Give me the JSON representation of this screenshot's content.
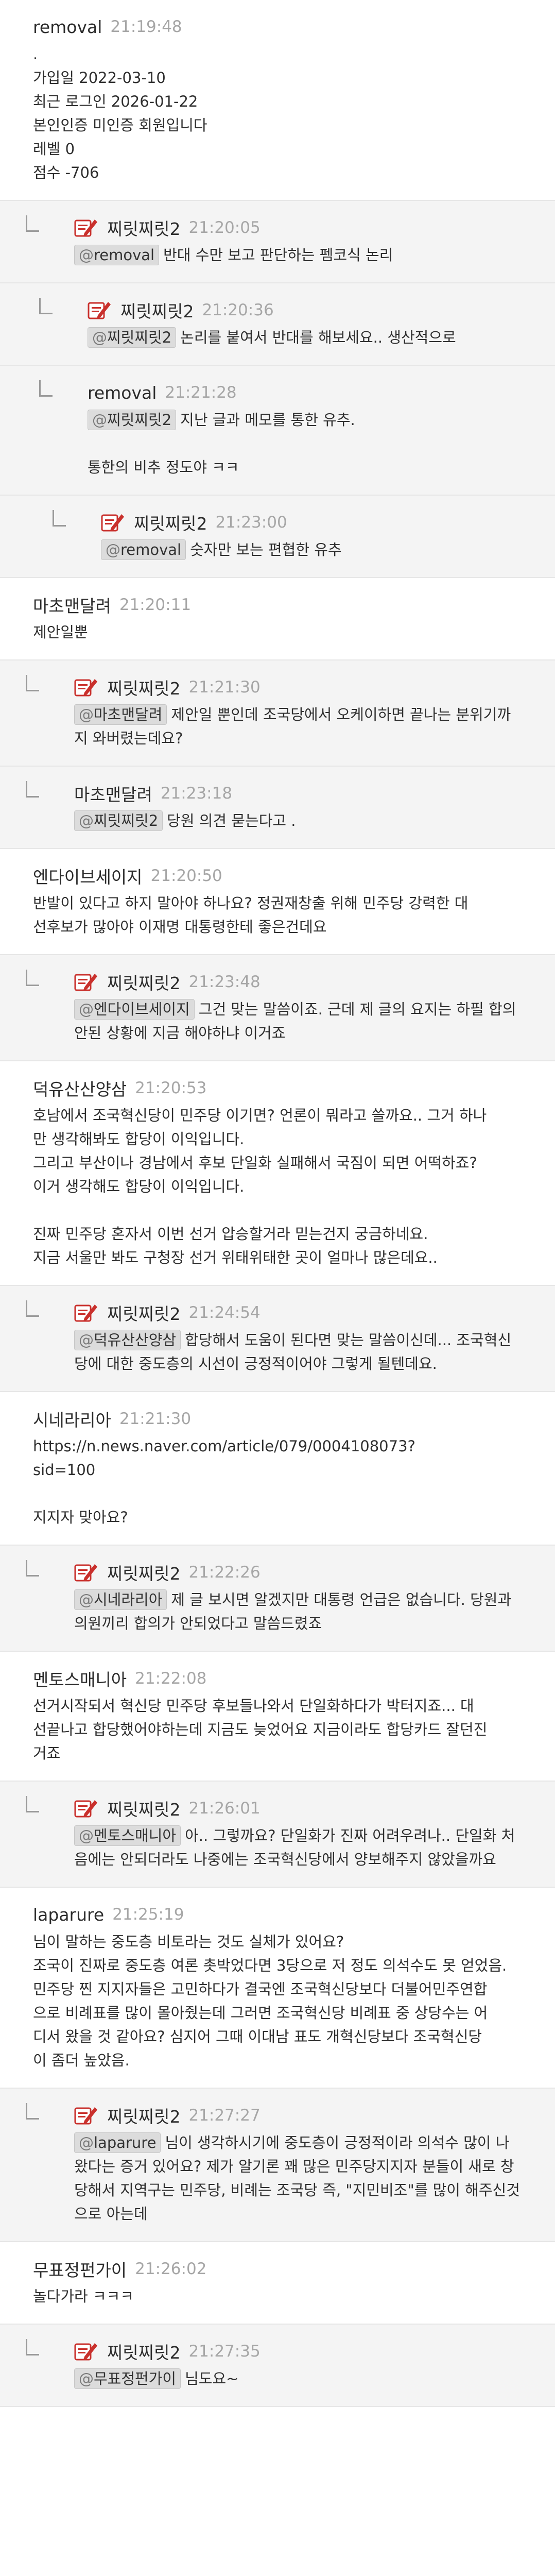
{
  "comments": [
    {
      "level": 0,
      "nick": "removal",
      "time": "21:19:48",
      "badge": false,
      "mention": "",
      "lines": [
        ".",
        "가입일 2022-03-10",
        "최근 로그인 2026-01-22",
        "본인인증 미인증 회원입니다",
        "레벨 0",
        "점수 -706"
      ]
    },
    {
      "level": 1,
      "nick": "찌릿찌릿2",
      "time": "21:20:05",
      "badge": true,
      "mention": "removal",
      "lines": [
        "반대 수만 보고 판단하는 펨코식 논리"
      ]
    },
    {
      "level": 2,
      "nick": "찌릿찌릿2",
      "time": "21:20:36",
      "badge": true,
      "mention": "찌릿찌릿2",
      "lines": [
        "논리를 붙여서 반대를 해보세요.. 생산적으로"
      ]
    },
    {
      "level": 2,
      "nick": "removal",
      "time": "21:21:28",
      "badge": false,
      "mention": "찌릿찌릿2",
      "lines": [
        "지난 글과 메모를 통한 유추.",
        "",
        "통한의 비추 정도야 ㅋㅋ"
      ]
    },
    {
      "level": 3,
      "nick": "찌릿찌릿2",
      "time": "21:23:00",
      "badge": true,
      "mention": "removal",
      "lines": [
        "숫자만 보는 편협한 유추"
      ]
    },
    {
      "level": 0,
      "nick": "마초맨달려",
      "time": "21:20:11",
      "badge": false,
      "mention": "",
      "lines": [
        "제안일뿐"
      ]
    },
    {
      "level": 1,
      "nick": "찌릿찌릿2",
      "time": "21:21:30",
      "badge": true,
      "mention": "마초맨달려",
      "lines": [
        "제안일 뿐인데 조국당에서 오케이하면 끝나는 분위기까",
        "지 와버렸는데요?"
      ]
    },
    {
      "level": 1,
      "nick": "마초맨달려",
      "time": "21:23:18",
      "badge": false,
      "mention": "찌릿찌릿2",
      "lines": [
        "당원 의견 묻는다고 ."
      ]
    },
    {
      "level": 0,
      "nick": "엔다이브세이지",
      "time": "21:20:50",
      "badge": false,
      "mention": "",
      "lines": [
        "반발이 있다고 하지 말아야 하나요? 정권재창출 위해 민주당 강력한 대",
        "선후보가 많아야 이재명 대통령한테 좋은건데요"
      ]
    },
    {
      "level": 1,
      "nick": "찌릿찌릿2",
      "time": "21:23:48",
      "badge": true,
      "mention": "엔다이브세이지",
      "lines": [
        "그건 맞는 말씀이죠. 근데 제 글의 요지는 하필 합의",
        "안된 상황에 지금 해야하냐 이거죠"
      ]
    },
    {
      "level": 0,
      "nick": "덕유산산양삼",
      "time": "21:20:53",
      "badge": false,
      "mention": "",
      "lines": [
        "호남에서 조국혁신당이 민주당 이기면? 언론이 뭐라고 쓸까요.. 그거 하나",
        "만 생각해봐도 합당이 이익입니다.",
        "그리고 부산이나 경남에서 후보 단일화 실패해서 국짐이 되면 어떡하죠?",
        "이거 생각해도 합당이 이익입니다.",
        "",
        "진짜 민주당 혼자서 이번 선거 압승할거라 믿는건지 궁금하네요.",
        "지금 서울만 봐도 구청장 선거 위태위태한 곳이 얼마나 많은데요.."
      ]
    },
    {
      "level": 1,
      "nick": "찌릿찌릿2",
      "time": "21:24:54",
      "badge": true,
      "mention": "덕유산산양삼",
      "lines": [
        "합당해서 도움이 된다면 맞는 말씀이신데... 조국혁신",
        "당에 대한 중도층의 시선이 긍정적이어야 그렇게 될텐데요."
      ]
    },
    {
      "level": 0,
      "nick": "시네라리아",
      "time": "21:21:30",
      "badge": false,
      "mention": "",
      "lines": [
        "https://n.news.naver.com/article/079/0004108073?",
        "sid=100",
        "",
        "지지자 맞아요?"
      ]
    },
    {
      "level": 1,
      "nick": "찌릿찌릿2",
      "time": "21:22:26",
      "badge": true,
      "mention": "시네라리아",
      "lines": [
        "제 글 보시면 알겠지만 대통령 언급은 없습니다. 당원과",
        "의원끼리 합의가 안되었다고 말씀드렸죠"
      ]
    },
    {
      "level": 0,
      "nick": "멘토스매니아",
      "time": "21:22:08",
      "badge": false,
      "mention": "",
      "lines": [
        "선거시작되서 혁신당 민주당 후보들나와서 단일화하다가 박터지죠... 대",
        "선끝나고 합당했어야하는데 지금도 늦었어요 지금이라도 합당카드 잘던진",
        "거죠"
      ]
    },
    {
      "level": 1,
      "nick": "찌릿찌릿2",
      "time": "21:26:01",
      "badge": true,
      "mention": "멘토스매니아",
      "lines": [
        "아.. 그렇까요? 단일화가 진짜 어려우려나.. 단일화 처",
        "음에는 안되더라도 나중에는 조국혁신당에서 양보해주지 않았을까요"
      ]
    },
    {
      "level": 0,
      "nick": "laparure",
      "time": "21:25:19",
      "badge": false,
      "mention": "",
      "lines": [
        "님이 말하는 중도층 비토라는 것도 실체가 있어요?",
        "조국이 진짜로 중도층 여론 촛박었다면 3당으로 저 정도 의석수도 못 얻었음.",
        "민주당 찐 지지자들은 고민하다가 결국엔 조국혁신당보다 더불어민주연합",
        "으로 비례표를 많이 몰아줬는데 그러면 조국혁신당 비례표 중 상당수는 어",
        "디서 왔을 것 같아요? 심지어 그때 이대남 표도 개혁신당보다 조국혁신당",
        "이 좀더 높았음."
      ]
    },
    {
      "level": 1,
      "nick": "찌릿찌릿2",
      "time": "21:27:27",
      "badge": true,
      "mention": "laparure",
      "lines": [
        "님이 생각하시기에 중도층이 긍정적이라 의석수 많이 나",
        "왔다는 증거 있어요? 제가 알기론 꽤 많은 민주당지지자 분들이 새로 창",
        "당해서 지역구는 민주당, 비례는 조국당 즉, \"지민비조\"를 많이 해주신것",
        "으로 아는데"
      ]
    },
    {
      "level": 0,
      "nick": "무표정펀가이",
      "time": "21:26:02",
      "badge": false,
      "mention": "",
      "lines": [
        "놀다가라 ㅋㅋㅋ"
      ]
    },
    {
      "level": 1,
      "nick": "찌릿찌릿2",
      "time": "21:27:35",
      "badge": true,
      "mention": "무표정펀가이",
      "lines": [
        "님도요~"
      ]
    }
  ]
}
